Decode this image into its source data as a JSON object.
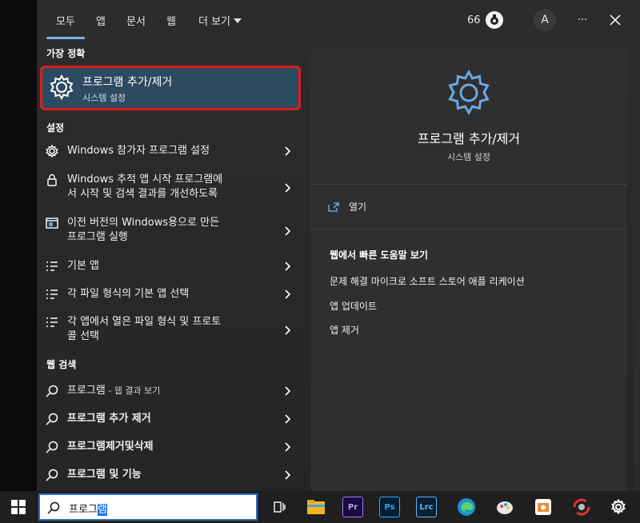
{
  "tabs": [
    {
      "label": "모두"
    },
    {
      "label": "앱"
    },
    {
      "label": "문서"
    },
    {
      "label": "웹"
    },
    {
      "label": "더 보기"
    }
  ],
  "top_right": {
    "points": "66",
    "avatar_letter": "A",
    "more_label": "···"
  },
  "best_match": {
    "section_label": "가장 정확",
    "title": "프로그램 추가/제거",
    "subtitle": "시스템 설정"
  },
  "settings": {
    "section_label": "설정",
    "items": [
      {
        "line1": "Windows 참가자 프로그램 설정",
        "line2": ""
      },
      {
        "line1": "Windows 추적 앱 시작 프로그램에",
        "line2": "서 시작 및 검색 결과를 개선하도록"
      },
      {
        "line1": "이전 버전의 Windows용으로 만든",
        "line2": "프로그램 실행"
      },
      {
        "line1": "기본 앱",
        "line2": ""
      },
      {
        "line1": "각 파일 형식의 기본 앱 선택",
        "line2": ""
      },
      {
        "line1": "각 앱에서 열은 파일 형식 및 프로토",
        "line2": "콜 선택"
      }
    ]
  },
  "web_search": {
    "section_label": "웹 검색",
    "items": [
      {
        "text": "프로그램",
        "sub": " - 웹 결과 보기"
      },
      {
        "text": "프로그램 추가 제거",
        "sub": ""
      },
      {
        "text": "프로그램제거및삭제",
        "sub": ""
      },
      {
        "text": "프로그램 및 기능",
        "sub": ""
      }
    ]
  },
  "preview": {
    "title": "프로그램 추가/제거",
    "subtitle": "시스템 설정",
    "open_label": "열기",
    "web_help_title": "웹에서 빠른 도움말 보기",
    "web_links": [
      "문제 해결 마이크로 소프트 스토어 애플 리케이션",
      "앱 업데이트",
      "앱 제거"
    ]
  },
  "taskbar": {
    "search_text_plain": "프로그",
    "search_text_selected": "램",
    "apps": [
      {
        "name": "file-explorer-icon",
        "label": ""
      },
      {
        "name": "premiere-icon",
        "label": "Pr"
      },
      {
        "name": "photoshop-icon",
        "label": "Ps"
      },
      {
        "name": "lightroom-icon",
        "label": "Lrc"
      },
      {
        "name": "edge-icon",
        "label": ""
      },
      {
        "name": "paint-icon",
        "label": ""
      },
      {
        "name": "photo-app-icon",
        "label": ""
      },
      {
        "name": "recorder-icon",
        "label": ""
      },
      {
        "name": "settings-gear-icon",
        "label": ""
      }
    ]
  },
  "colors": {
    "accent": "#7ab0e8",
    "highlight_border": "#e31b1b",
    "best_match_bg": "#2d4a63",
    "search_border": "#2a71c7"
  }
}
